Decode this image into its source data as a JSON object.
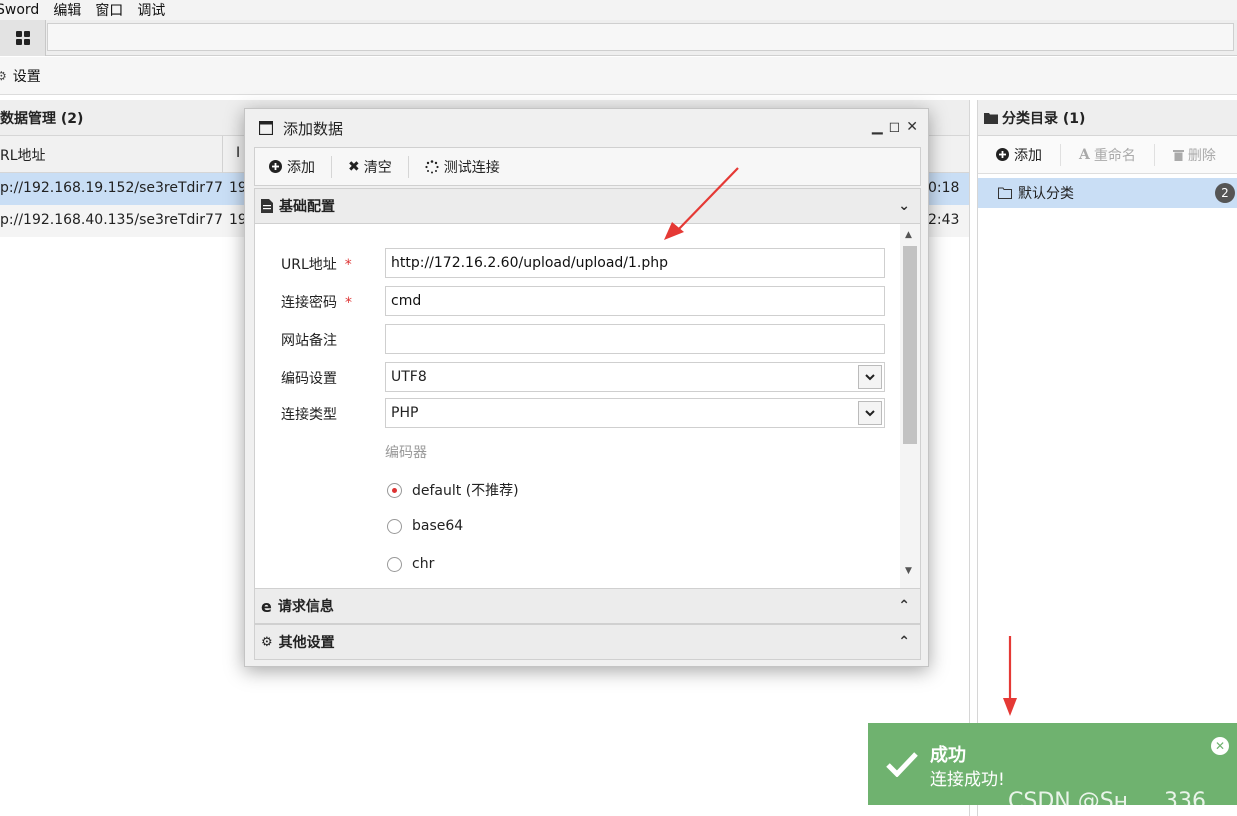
{
  "menubar": {
    "items": [
      "Sword",
      "编辑",
      "窗口",
      "调试"
    ]
  },
  "settings": {
    "label": "设置"
  },
  "data_panel": {
    "title": "数据管理 (2)",
    "columns": [
      "RL地址",
      "I"
    ],
    "rows": [
      {
        "url": "p://192.168.19.152/se3reTdir77",
        "ip": "19",
        "time": "0:18"
      },
      {
        "url": "p://192.168.40.135/se3reTdir77",
        "ip": "19",
        "time": "2:43"
      }
    ]
  },
  "category_panel": {
    "title": "分类目录 (1)",
    "add_label": "添加",
    "rename_label": "重命名",
    "delete_label": "删除",
    "default_category": "默认分类",
    "default_count": "2"
  },
  "dialog": {
    "title": "添加数据",
    "toolbar": {
      "add": "添加",
      "clear": "清空",
      "test": "测试连接"
    },
    "section_basic": "基础配置",
    "section_request": "请求信息",
    "section_other": "其他设置",
    "form": {
      "url_label": "URL地址",
      "url_value": "http://172.16.2.60/upload/upload/1.php",
      "password_label": "连接密码",
      "password_value": "cmd",
      "note_label": "网站备注",
      "note_value": "",
      "encoding_label": "编码设置",
      "encoding_value": "UTF8",
      "type_label": "连接类型",
      "type_value": "PHP",
      "encoder_label": "编码器",
      "encoders": [
        "default (不推荐)",
        "base64",
        "chr"
      ],
      "required_mark": "*"
    }
  },
  "toast": {
    "title": "成功",
    "message": "连接成功!",
    "watermark": "CSDN @Sн　. 336"
  },
  "colors": {
    "selection": "#c9def5",
    "toast_bg": "#6fb26f",
    "required": "#dd3333",
    "arrow": "#e53935"
  }
}
